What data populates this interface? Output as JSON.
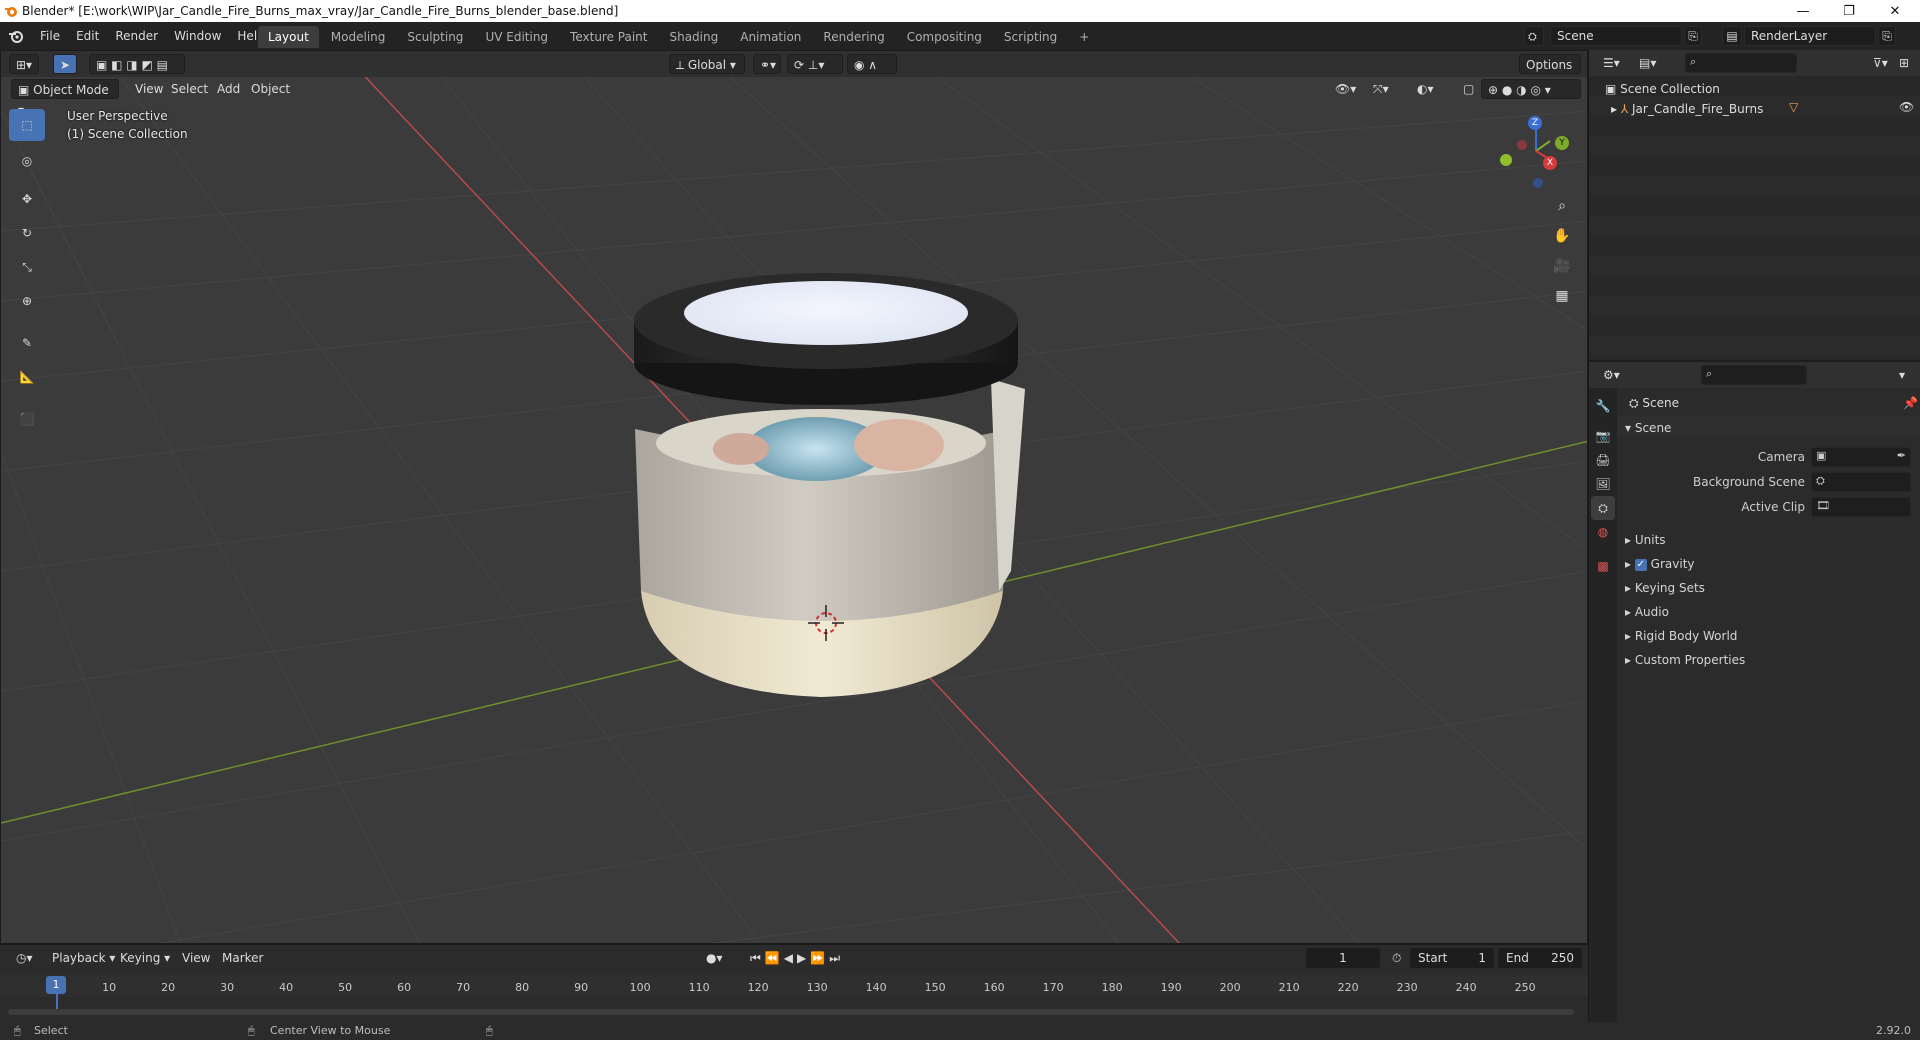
{
  "window": {
    "title": "Blender* [E:\\work\\WIP\\Jar_Candle_Fire_Burns_max_vray/Jar_Candle_Fire_Burns_blender_base.blend]",
    "min": "—",
    "max": "❐",
    "close": "✕"
  },
  "menu": [
    "File",
    "Edit",
    "Render",
    "Window",
    "Help"
  ],
  "workspaces": [
    "Layout",
    "Modeling",
    "Sculpting",
    "UV Editing",
    "Texture Paint",
    "Shading",
    "Animation",
    "Rendering",
    "Compositing",
    "Scripting"
  ],
  "workspace_add": "+",
  "scene_field": "Scene",
  "renderlayer_field": "RenderLayer",
  "viewport": {
    "mode": "Object Mode",
    "menus": [
      "View",
      "Select",
      "Add",
      "Object"
    ],
    "transform_orientation": "Global",
    "options_label": "Options",
    "overlay_line1": "User Perspective",
    "overlay_line2": "(1) Scene Collection",
    "gizmo": {
      "x": "X",
      "y": "Y",
      "z": "Z"
    }
  },
  "outliner": {
    "root": "Scene Collection",
    "items": [
      {
        "label": "Jar_Candle_Fire_Burns"
      }
    ]
  },
  "properties": {
    "header": "Scene",
    "section_title": "Scene",
    "rows": [
      {
        "label": "Camera",
        "value": ""
      },
      {
        "label": "Background Scene",
        "value": ""
      },
      {
        "label": "Active Clip",
        "value": ""
      }
    ],
    "subsections": [
      "Units",
      "Gravity",
      "Keying Sets",
      "Audio",
      "Rigid Body World",
      "Custom Properties"
    ],
    "gravity_checked": true
  },
  "timeline": {
    "menus": [
      "Playback",
      "Keying",
      "View",
      "Marker"
    ],
    "current_frame": "1",
    "start_label": "Start",
    "start": "1",
    "end_label": "End",
    "end": "250",
    "ticks": [
      "10",
      "20",
      "30",
      "40",
      "50",
      "60",
      "70",
      "80",
      "90",
      "100",
      "110",
      "120",
      "130",
      "140",
      "150",
      "160",
      "170",
      "180",
      "190",
      "200",
      "210",
      "220",
      "230",
      "240",
      "250"
    ],
    "playhead_label": "1"
  },
  "statusbar": {
    "select": "Select",
    "center": "Center View to Mouse",
    "version": "2.92.0"
  },
  "colors": {
    "accent": "#4772b3",
    "viewport_bg": "#3b3b3b",
    "x_axis": "#c23a3a",
    "y_axis": "#6a9a2a",
    "z_axis": "#3b6fd8"
  }
}
